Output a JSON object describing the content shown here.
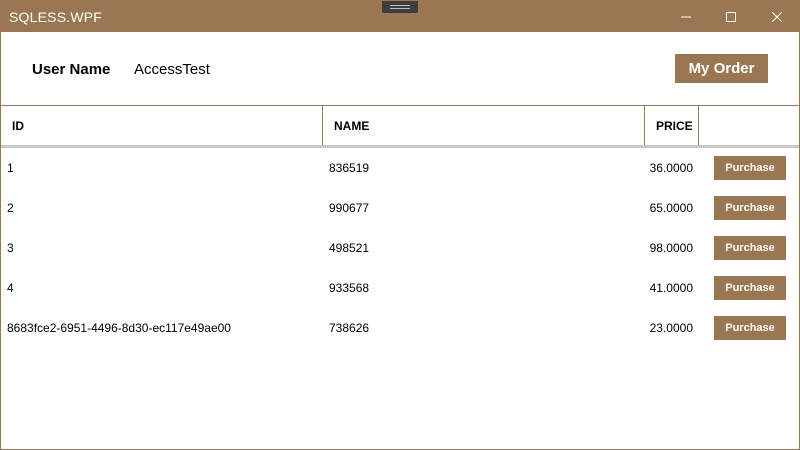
{
  "window": {
    "title": "SQLESS.WPF",
    "accent_color": "#9a7752",
    "controls": [
      "minimize-icon",
      "maximize-icon",
      "close-icon"
    ]
  },
  "header": {
    "user_label": "User Name",
    "user_value": "AccessTest",
    "my_order_label": "My Order"
  },
  "table": {
    "columns": {
      "id": "ID",
      "name": "NAME",
      "price": "PRICE"
    },
    "rows": [
      {
        "id": "1",
        "name": "836519",
        "price": "36.0000",
        "action": "Purchase"
      },
      {
        "id": "2",
        "name": "990677",
        "price": "65.0000",
        "action": "Purchase"
      },
      {
        "id": "3",
        "name": "498521",
        "price": "98.0000",
        "action": "Purchase"
      },
      {
        "id": "4",
        "name": "933568",
        "price": "41.0000",
        "action": "Purchase"
      },
      {
        "id": "8683fce2-6951-4496-8d30-ec117e49ae00",
        "name": "738626",
        "price": "23.0000",
        "action": "Purchase"
      }
    ]
  }
}
